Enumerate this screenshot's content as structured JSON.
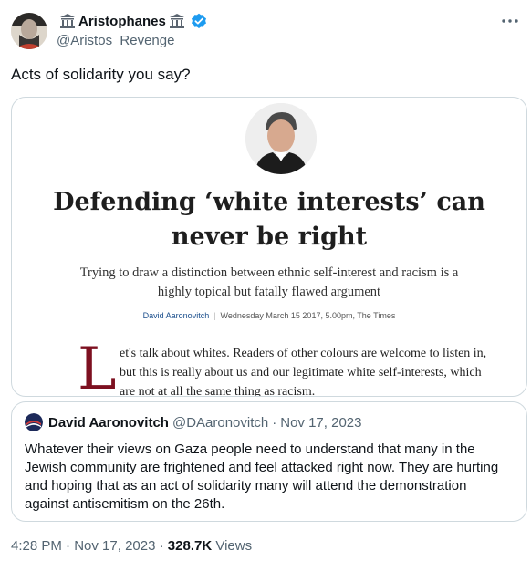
{
  "author": {
    "name": "Aristophanes",
    "handle": "@Aristos_Revenge"
  },
  "tweet": {
    "text": "Acts of solidarity you say?",
    "time": "4:28 PM",
    "date": "Nov 17, 2023",
    "views_count": "328.7K",
    "views_label": "Views"
  },
  "article": {
    "headline_line1": "Defending ‘white interests’ can",
    "headline_line2": "never be right",
    "standfirst": "Trying to draw a distinction between ethnic self-interest and racism is a highly topical but fatally flawed argument",
    "byline_author": "David Aaronovitch",
    "byline_date": "Wednesday March 15 2017, 5.00pm, The Times",
    "dropcap": "L",
    "body_line1": "et's talk about whites. Readers of other colours are welcome to listen in,",
    "body_line2": "but this is really about us and our legitimate white self-interests, which",
    "body_line3": "are not at all the same thing as racism."
  },
  "quoted": {
    "name": "David Aaronovitch",
    "handle": "@DAaronovitch",
    "separator": "·",
    "date": "Nov 17, 2023",
    "text": "Whatever their views on Gaza people need to understand that many in the Jewish community are frightened and feel attacked right now. They are hurting and hoping that as an act of solidarity many will attend the demonstration against antisemitism on the 26th."
  },
  "meta_separator": "·",
  "icons": {
    "author_avatar": "avatar-icon",
    "name_emoji": "classical-building-icon",
    "verified": "verified-badge-icon",
    "more": "more-options-icon",
    "quoted_avatar": "avatar-icon"
  },
  "colors": {
    "verified_blue": "#1d9bf0",
    "secondary_text": "#536471",
    "border": "#cfd9de",
    "dropcap_red": "#7d1020"
  }
}
